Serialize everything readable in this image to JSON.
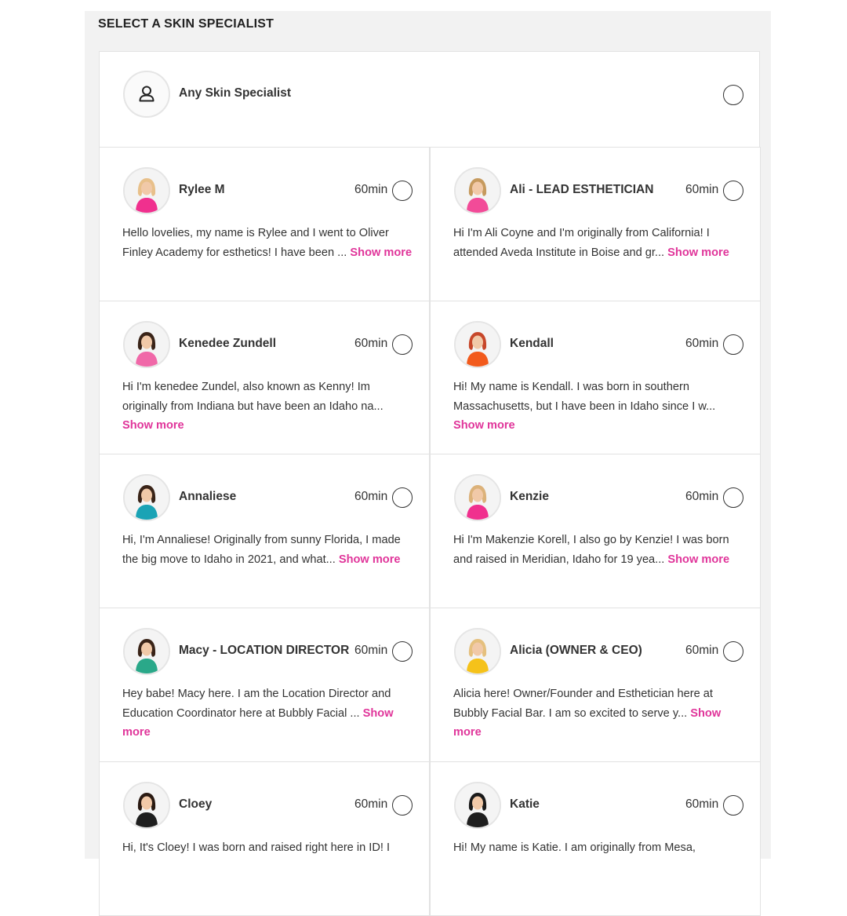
{
  "header": {
    "title": "SELECT A SKIN SPECIALIST"
  },
  "any_specialist": {
    "label": "Any Skin Specialist",
    "icon": "user-outline-icon"
  },
  "specialists": [
    {
      "name": "Rylee M",
      "duration": "60min",
      "bio": "Hello lovelies, my name is Rylee and I went to Oliver Finley Academy for esthetics! I have been ...",
      "show_more": "Show more",
      "shirt": "#f0308e",
      "hair": "#e8c08a"
    },
    {
      "name": "Ali - LEAD ESTHETICIAN",
      "duration": "60min",
      "bio": "Hi I'm Ali Coyne and I'm originally from California! I attended Aveda Institute in Boise and gr...",
      "show_more": "Show more",
      "shirt": "#f24b98",
      "hair": "#c69a5e"
    },
    {
      "name": "Kenedee Zundell",
      "duration": "60min",
      "bio": "Hi I'm kenedee Zundel, also known as Kenny! Im originally from Indiana but have been an Idaho na...",
      "show_more": "Show more",
      "shirt": "#f068a8",
      "hair": "#3a2418"
    },
    {
      "name": "Kendall",
      "duration": "60min",
      "bio": "Hi! My name is Kendall. I was born in southern Massachusetts, but I have been in Idaho since I w...",
      "show_more": "Show more",
      "shirt": "#f25a1c",
      "hair": "#c7472a"
    },
    {
      "name": "Annaliese",
      "duration": "60min",
      "bio": "Hi, I'm Annaliese! Originally from sunny Florida, I made the big move to Idaho in 2021, and what...",
      "show_more": "Show more",
      "shirt": "#1aa3b5",
      "hair": "#3a2418"
    },
    {
      "name": "Kenzie",
      "duration": "60min",
      "bio": "Hi I'm Makenzie Korell, I also go by Kenzie! I was born and raised in Meridian, Idaho for 19 yea...",
      "show_more": "Show more",
      "shirt": "#f0308e",
      "hair": "#dcb27a"
    },
    {
      "name": "Macy - LOCATION DIRECTOR",
      "duration": "60min",
      "bio": "Hey babe! Macy here. I am the Location Director and Education Coordinator here at Bubbly Facial ...",
      "show_more": "Show more",
      "shirt": "#2aa889",
      "hair": "#3a2418"
    },
    {
      "name": "Alicia (OWNER & CEO)",
      "duration": "60min",
      "bio": "Alicia here! Owner/Founder and Esthetician here at Bubbly Facial Bar. I am so excited to serve y...",
      "show_more": "Show more",
      "shirt": "#f5c21a",
      "hair": "#e5c07e"
    },
    {
      "name": "Cloey",
      "duration": "60min",
      "bio": "Hi, It's Cloey! I was born and raised right here in ID! I",
      "show_more": "",
      "shirt": "#1e1e1e",
      "hair": "#2a1a12"
    },
    {
      "name": "Katie",
      "duration": "60min",
      "bio": "Hi! My name is Katie. I am originally from Mesa,",
      "show_more": "",
      "shirt": "#1e1e1e",
      "hair": "#1a1a1a"
    }
  ]
}
